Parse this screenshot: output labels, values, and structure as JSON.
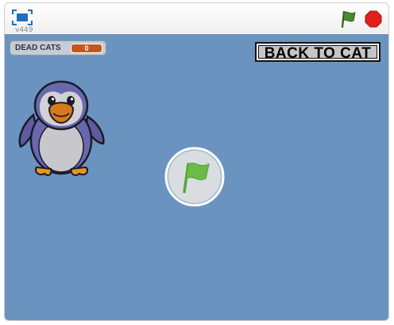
{
  "player": {
    "version": "v449",
    "controls": {
      "fullscreen_icon": "fullscreen-icon",
      "green_flag_icon": "green-flag-icon",
      "stop_icon": "stop-icon"
    }
  },
  "stage": {
    "background_color": "#6b93bf",
    "variable_monitor": {
      "label": "DEAD CATS",
      "value": "0"
    },
    "back_button": {
      "label": "BACK TO CAT"
    },
    "sprite": {
      "name_icon": "penguin-sprite"
    },
    "start_overlay": {
      "icon": "green-flag-icon"
    }
  },
  "colors": {
    "accent_blue": "#1d6fc2",
    "flag_green": "#4a8c2a",
    "stop_red": "#e0201c",
    "monitor_value_bg": "#c2581c"
  }
}
